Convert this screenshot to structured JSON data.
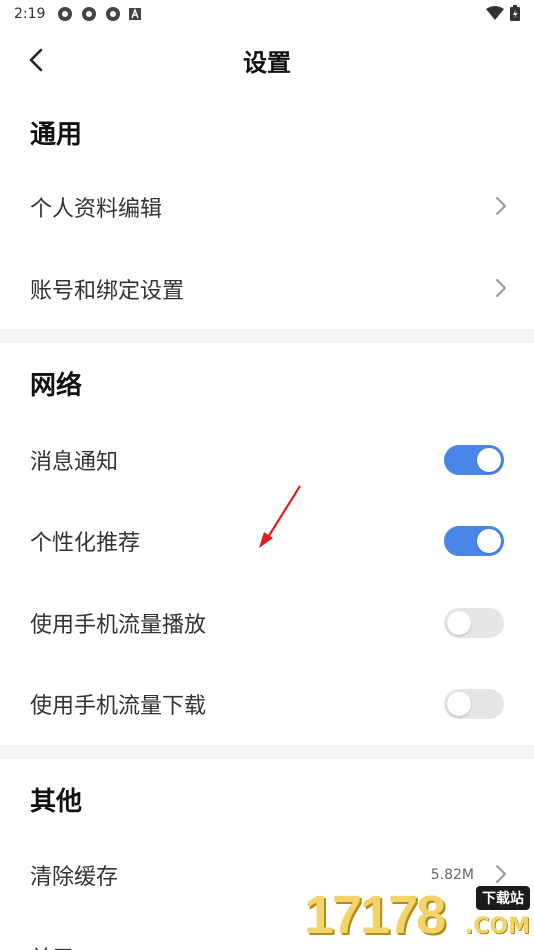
{
  "status_bar": {
    "time": "2:19"
  },
  "nav": {
    "title": "设置"
  },
  "sections": {
    "general": {
      "title": "通用",
      "items": [
        {
          "label": "个人资料编辑"
        },
        {
          "label": "账号和绑定设置"
        }
      ]
    },
    "network": {
      "title": "网络",
      "items": [
        {
          "label": "消息通知",
          "enabled": true
        },
        {
          "label": "个性化推荐",
          "enabled": true
        },
        {
          "label": "使用手机流量播放",
          "enabled": false
        },
        {
          "label": "使用手机流量下载",
          "enabled": false
        }
      ]
    },
    "other": {
      "title": "其他",
      "items": [
        {
          "label": "清除缓存",
          "value": "5.82M"
        },
        {
          "label": "关于"
        }
      ]
    }
  },
  "watermark": {
    "number": "17178",
    "badge": "下载站",
    "suffix": ".COM"
  },
  "colors": {
    "accent": "#4a86e8",
    "toggle_off": "#e6e6e6",
    "band": "#f5f5f5",
    "annotation_arrow": "#e02020"
  }
}
